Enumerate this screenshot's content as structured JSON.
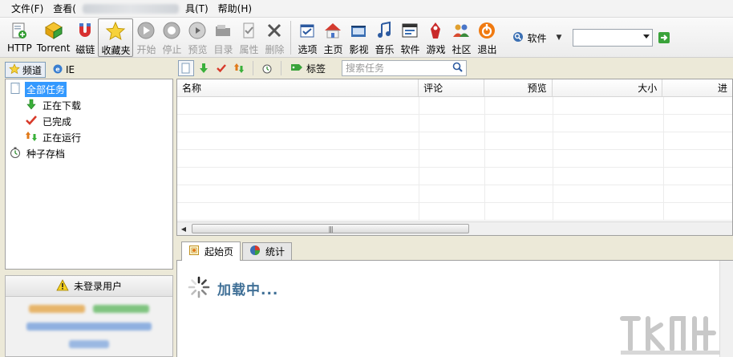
{
  "menubar": {
    "items": [
      {
        "label": "文件(F)"
      },
      {
        "label": "查看("
      },
      {
        "label": "具(T)"
      },
      {
        "label": "帮助(H)"
      }
    ]
  },
  "toolbar": {
    "buttons": [
      {
        "label": "HTTP",
        "icon": "http-add-icon",
        "state": "normal"
      },
      {
        "label": "Torrent",
        "icon": "torrent-icon",
        "state": "normal"
      },
      {
        "label": "磁链",
        "icon": "magnet-icon",
        "state": "normal"
      },
      {
        "label": "收藏夹",
        "icon": "star-icon",
        "state": "active"
      },
      {
        "label": "开始",
        "icon": "play-icon",
        "state": "disabled"
      },
      {
        "label": "停止",
        "icon": "stop-icon",
        "state": "disabled"
      },
      {
        "label": "预览",
        "icon": "preview-icon",
        "state": "disabled"
      },
      {
        "label": "目录",
        "icon": "folder-icon",
        "state": "disabled"
      },
      {
        "label": "属性",
        "icon": "properties-icon",
        "state": "disabled"
      },
      {
        "label": "删除",
        "icon": "delete-icon",
        "state": "disabled"
      },
      {
        "label": "选项",
        "icon": "options-icon",
        "state": "normal"
      },
      {
        "label": "主页",
        "icon": "home-icon",
        "state": "normal"
      },
      {
        "label": "影视",
        "icon": "film-icon",
        "state": "normal"
      },
      {
        "label": "音乐",
        "icon": "music-icon",
        "state": "normal"
      },
      {
        "label": "软件",
        "icon": "software-icon",
        "state": "normal"
      },
      {
        "label": "游戏",
        "icon": "game-icon",
        "state": "normal"
      },
      {
        "label": "社区",
        "icon": "community-icon",
        "state": "normal"
      },
      {
        "label": "退出",
        "icon": "power-icon",
        "state": "normal"
      }
    ],
    "search_category": "软件",
    "search_value": ""
  },
  "left": {
    "tabs": [
      {
        "label": "频道",
        "active": true
      },
      {
        "label": "IE",
        "active": false
      }
    ],
    "tree": [
      {
        "label": "全部任务",
        "icon": "all-tasks-icon",
        "level": 0,
        "selected": true
      },
      {
        "label": "正在下载",
        "icon": "downloading-icon",
        "level": 1,
        "selected": false
      },
      {
        "label": "已完成",
        "icon": "completed-icon",
        "level": 1,
        "selected": false
      },
      {
        "label": "正在运行",
        "icon": "running-icon",
        "level": 1,
        "selected": false
      },
      {
        "label": "种子存档",
        "icon": "seed-archive-icon",
        "level": 0,
        "selected": false
      }
    ],
    "user_panel": {
      "title": "未登录用户"
    }
  },
  "task_toolbar": {
    "tag_label": "标签",
    "search_placeholder": "搜索任务"
  },
  "task_table": {
    "columns": [
      {
        "label": "名称",
        "align": "left"
      },
      {
        "label": "评论",
        "align": "left"
      },
      {
        "label": "预览",
        "align": "right"
      },
      {
        "label": "大小",
        "align": "right"
      },
      {
        "label": "进",
        "align": "left"
      }
    ],
    "rows": []
  },
  "bottom": {
    "tabs": [
      {
        "label": "起始页",
        "active": true
      },
      {
        "label": "统计",
        "active": false
      }
    ],
    "loading_text": "加载中..."
  },
  "colors": {
    "selection": "#3399ff",
    "loading_text": "#3f6f96"
  }
}
